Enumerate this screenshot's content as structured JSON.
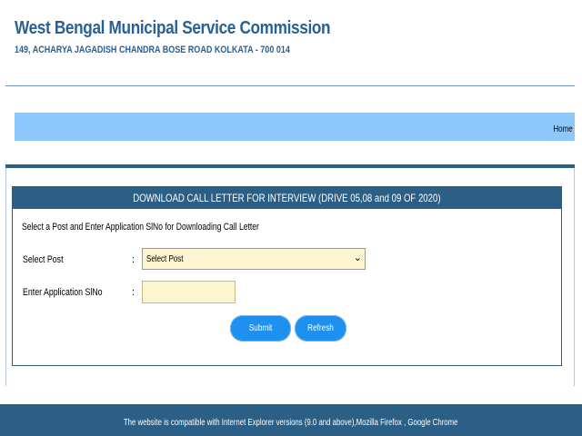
{
  "header": {
    "title": "West Bengal Municipal Service Commission",
    "address": "149, ACHARYA JAGADISH CHANDRA BOSE ROAD KOLKATA - 700 014"
  },
  "nav": {
    "home_label": "Home"
  },
  "panel": {
    "title": "DOWNLOAD CALL LETTER FOR INTERVIEW (DRIVE 05,08 and 09 OF 2020)",
    "instruction": "Select a Post and Enter Application SlNo for Downloading Call Letter",
    "post_label": "Select Post",
    "post_colon": ":",
    "post_selected": "Select Post",
    "app_label": "Enter Application SlNo",
    "app_colon": ":",
    "app_value": "",
    "submit_label": "Submit",
    "refresh_label": "Refresh"
  },
  "footer": {
    "text": "The website is compatible with Internet Explorer versions (9.0 and above),Mozilla Firefox , Google Chrome"
  },
  "colors": {
    "brand_blue": "#2c5f86",
    "nav_blue": "#8ec7fa",
    "button_blue": "#1e90ef",
    "input_bg": "#fdf5cf"
  }
}
